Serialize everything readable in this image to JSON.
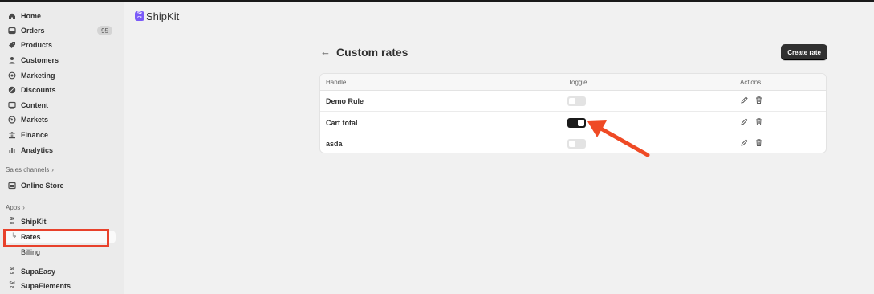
{
  "sidebar": {
    "items": [
      {
        "label": "Home",
        "icon": "home-icon"
      },
      {
        "label": "Orders",
        "icon": "orders-icon",
        "badge": "95"
      },
      {
        "label": "Products",
        "icon": "tag-icon"
      },
      {
        "label": "Customers",
        "icon": "person-icon"
      },
      {
        "label": "Marketing",
        "icon": "target-icon"
      },
      {
        "label": "Discounts",
        "icon": "discount-icon"
      },
      {
        "label": "Content",
        "icon": "content-icon"
      },
      {
        "label": "Markets",
        "icon": "globe-icon"
      },
      {
        "label": "Finance",
        "icon": "bank-icon"
      },
      {
        "label": "Analytics",
        "icon": "bar-chart-icon"
      }
    ],
    "sales_channels_label": "Sales channels",
    "online_store": {
      "label": "Online Store",
      "icon": "store-icon"
    },
    "apps_label": "Apps",
    "apps": [
      {
        "label": "ShipKit",
        "logo": "Sk"
      },
      {
        "label": "SupaEasy",
        "logo": "Se"
      },
      {
        "label": "SupaElements",
        "logo": "Sel"
      }
    ],
    "shipkit_sub": [
      {
        "label": "Rates",
        "active": true
      },
      {
        "label": "Billing",
        "active": false
      }
    ]
  },
  "header": {
    "app_name": "ShipKit",
    "app_icon_text": "Sk",
    "app_icon_color": "#7a5af8"
  },
  "page": {
    "back_icon": "arrow-left-icon",
    "title": "Custom rates",
    "create_button": "Create rate"
  },
  "table": {
    "headers": [
      "Handle",
      "Toggle",
      "Actions"
    ],
    "rows": [
      {
        "handle": "Demo Rule",
        "enabled": false
      },
      {
        "handle": "Cart total",
        "enabled": true
      },
      {
        "handle": "asda",
        "enabled": false
      }
    ]
  },
  "annotations": {
    "highlight_color": "#e8412b",
    "arrow_color": "#ef4a25"
  }
}
